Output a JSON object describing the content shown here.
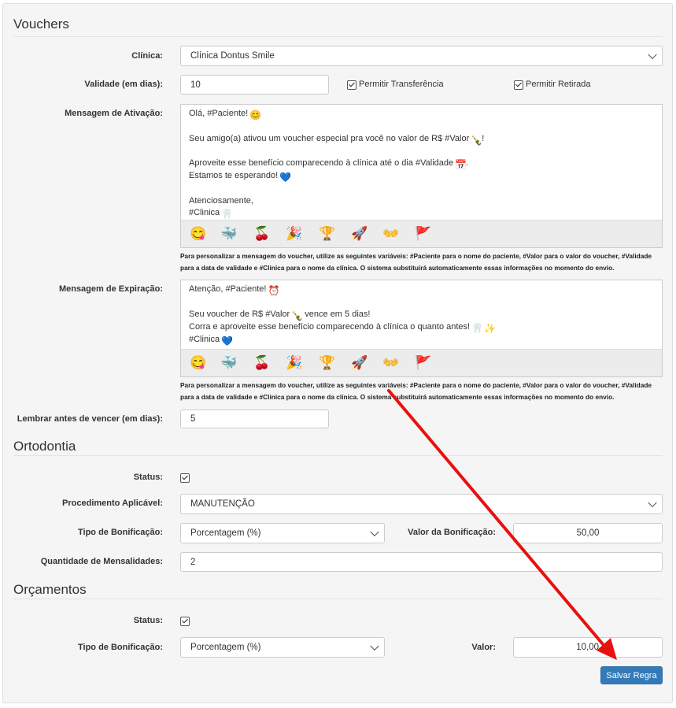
{
  "vouchers": {
    "title": "Vouchers",
    "clinica_label": "Clínica:",
    "clinica_value": "Clínica Dontus Smile",
    "validade_label": "Validade (em dias):",
    "validade_value": "10",
    "permitir_transferencia": "Permitir Transferência",
    "permitir_retirada": "Permitir Retirada",
    "ativacao_label": "Mensagem de Ativação:",
    "ativacao_lines": {
      "l1": "Olá, #Paciente!",
      "l2": "Seu amigo(a) ativou um voucher especial pra você no valor de R$ #Valor",
      "l2b": "!",
      "l3": "Aproveite esse benefício comparecendo à clínica até o dia #Validade",
      "l3b": ".",
      "l4": "Estamos te esperando!",
      "l5": "Atenciosamente,",
      "l6": "#Clinica"
    },
    "expiracao_label": "Mensagem de Expiração:",
    "expiracao_lines": {
      "l1": "Atenção, #Paciente!",
      "l2": "Seu voucher de R$ #Valor",
      "l2b": "vence em 5 dias!",
      "l3": "Corra e aproveite esse benefício comparecendo à clínica o quanto antes!",
      "l4": "#Clinica"
    },
    "help_text": "Para personalizar a mensagem do voucher, utilize as seguintes variáveis: #Paciente para o nome do paciente, #Valor para o valor do voucher, #Validade para a data de validade e #Clinica para o nome da clínica. O sistema substituirá automaticamente essas informações no momento do envio.",
    "lembrar_label": "Lembrar antes de vencer (em dias):",
    "lembrar_value": "5",
    "emoji_icons": [
      "smile-emoji-icon",
      "whale-emoji-icon",
      "cherries-emoji-icon",
      "party-popper-emoji-icon",
      "trophy-emoji-icon",
      "rocket-emoji-icon",
      "hands-emoji-icon",
      "flag-emoji-icon"
    ]
  },
  "ortodontia": {
    "title": "Ortodontia",
    "status_label": "Status:",
    "procedimento_label": "Procedimento Aplicável:",
    "procedimento_value": "MANUTENÇÃO",
    "tipo_label": "Tipo de Bonificação:",
    "tipo_value": "Porcentagem (%)",
    "valor_label": "Valor da Bonificação:",
    "valor_value": "50,00",
    "qtd_label": "Quantidade de Mensalidades:",
    "qtd_value": "2"
  },
  "orcamentos": {
    "title": "Orçamentos",
    "status_label": "Status:",
    "tipo_label": "Tipo de Bonificação:",
    "tipo_value": "Porcentagem (%)",
    "valor_label": "Valor:",
    "valor_value": "10,00"
  },
  "save_label": "Salvar Regra",
  "colors": {
    "primary": "#337ab7",
    "annotation_arrow": "#e8110f"
  }
}
